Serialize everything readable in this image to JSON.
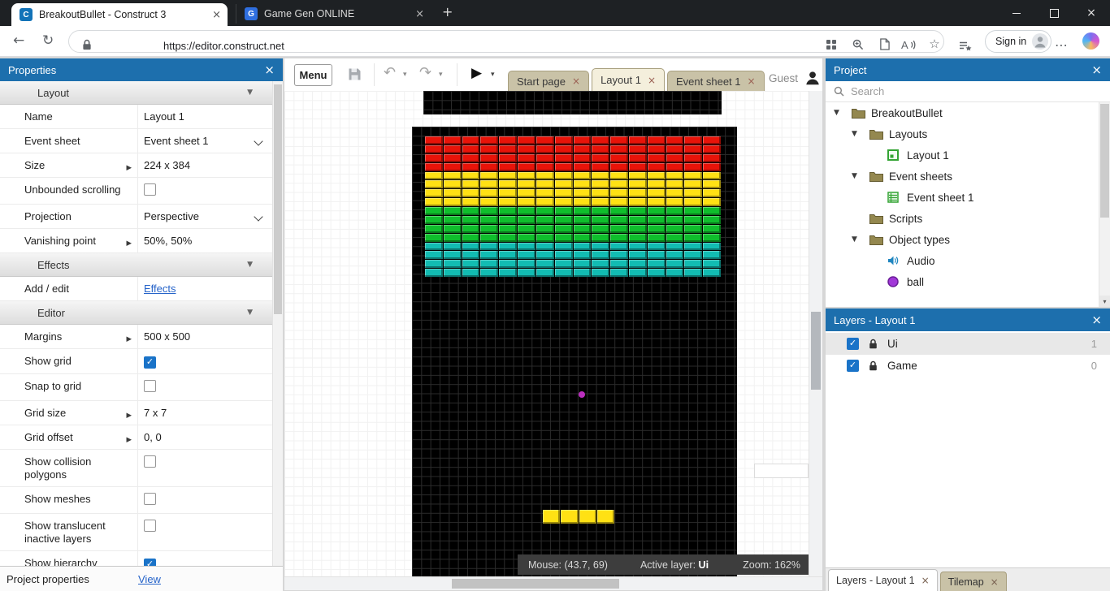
{
  "colors": {
    "panel_header": "#1d6fad",
    "checkbox_accent": "#1a73c8",
    "link": "#2563c9",
    "brick_red": "#e81309",
    "brick_yellow": "#ffe114",
    "brick_green": "#0fbe2c",
    "brick_cyan": "#12bcb2",
    "ball": "#bb2fbe",
    "paddle": "#ffe114"
  },
  "glyphs": {
    "back": "←",
    "reload": "↻",
    "undo": "↶",
    "redo": "↷",
    "play": "▶",
    "caret_down": "▾",
    "close": "×",
    "star": "☆",
    "dots": "⋯",
    "plus": "+",
    "check": "✓",
    "section_caret": "▼",
    "expand_caret": "▶",
    "tree_caret": "▼"
  },
  "browser": {
    "tabs": [
      {
        "title": "BreakoutBullet - Construct 3",
        "favicon_letter": "C",
        "active": true
      },
      {
        "title": "Game Gen ONLINE",
        "favicon_letter": "G",
        "active": false
      }
    ],
    "url": "https://editor.construct.net",
    "sign_in_label": "Sign in"
  },
  "toolbar": {
    "menu_label": "Menu"
  },
  "doc_tabs": [
    {
      "label": "Start page",
      "active": false
    },
    {
      "label": "Layout 1",
      "active": true
    },
    {
      "label": "Event sheet 1",
      "active": false
    }
  ],
  "guest_label": "Guest",
  "properties_panel": {
    "title": "Properties",
    "rows": [
      {
        "type": "section",
        "label": "Layout"
      },
      {
        "type": "text",
        "label": "Name",
        "value": "Layout 1"
      },
      {
        "type": "dropdown",
        "label": "Event sheet",
        "value": "Event sheet 1"
      },
      {
        "type": "expand",
        "label": "Size",
        "value": "224 x 384"
      },
      {
        "type": "checkbox",
        "label": "Unbounded scrolling",
        "checked": false
      },
      {
        "type": "dropdown",
        "label": "Projection",
        "value": "Perspective"
      },
      {
        "type": "expand",
        "label": "Vanishing point",
        "value": "50%, 50%"
      },
      {
        "type": "section",
        "label": "Effects"
      },
      {
        "type": "link",
        "label": "Add / edit",
        "value": "Effects"
      },
      {
        "type": "section",
        "label": "Editor"
      },
      {
        "type": "expand",
        "label": "Margins",
        "value": "500 x 500"
      },
      {
        "type": "checkbox",
        "label": "Show grid",
        "checked": true
      },
      {
        "type": "checkbox",
        "label": "Snap to grid",
        "checked": false
      },
      {
        "type": "expand",
        "label": "Grid size",
        "value": "7 x 7"
      },
      {
        "type": "expand",
        "label": "Grid offset",
        "value": "0, 0"
      },
      {
        "type": "checkbox",
        "label": "Show collision polygons",
        "checked": false
      },
      {
        "type": "checkbox",
        "label": "Show meshes",
        "checked": false
      },
      {
        "type": "checkbox",
        "label": "Show translucent inactive layers",
        "checked": false
      },
      {
        "type": "checkbox",
        "label": "Show hierarchy",
        "checked": true
      }
    ],
    "footer": {
      "label": "Project properties",
      "link": "View"
    }
  },
  "canvas": {
    "status": {
      "mouse": "Mouse: (43.7, 69)",
      "active_layer_label": "Active layer:",
      "active_layer": "Ui",
      "zoom": "Zoom: 162%"
    },
    "bricks": {
      "cols": 16,
      "rows_per_color": 4,
      "colors": [
        "#e81309",
        "#ffe114",
        "#0fbe2c",
        "#12bcb2"
      ]
    },
    "ball_color": "#bb2fbe",
    "paddle_color": "#ffe114",
    "paddle_segments": 4
  },
  "project_panel": {
    "title": "Project",
    "search_placeholder": "Search",
    "tree": [
      {
        "label": "BreakoutBullet",
        "depth": 0,
        "icon": "folder",
        "expanded": true
      },
      {
        "label": "Layouts",
        "depth": 1,
        "icon": "folder",
        "expanded": true
      },
      {
        "label": "Layout 1",
        "depth": 2,
        "icon": "layout",
        "expanded": false
      },
      {
        "label": "Event sheets",
        "depth": 1,
        "icon": "folder",
        "expanded": true
      },
      {
        "label": "Event sheet 1",
        "depth": 2,
        "icon": "eventsheet",
        "expanded": false
      },
      {
        "label": "Scripts",
        "depth": 1,
        "icon": "folder",
        "expanded": false
      },
      {
        "label": "Object types",
        "depth": 1,
        "icon": "folder",
        "expanded": true
      },
      {
        "label": "Audio",
        "depth": 2,
        "icon": "audio",
        "expanded": false
      },
      {
        "label": "ball",
        "depth": 2,
        "icon": "ball",
        "expanded": false
      }
    ]
  },
  "layers_panel": {
    "title": "Layers - Layout 1",
    "layers": [
      {
        "name": "Ui",
        "index": "1",
        "checked": true,
        "locked": true,
        "selected": true
      },
      {
        "name": "Game",
        "index": "0",
        "checked": true,
        "locked": true,
        "selected": false
      }
    ],
    "tabs": [
      {
        "label": "Layers - Layout 1",
        "active": true
      },
      {
        "label": "Tilemap",
        "active": false
      }
    ]
  }
}
